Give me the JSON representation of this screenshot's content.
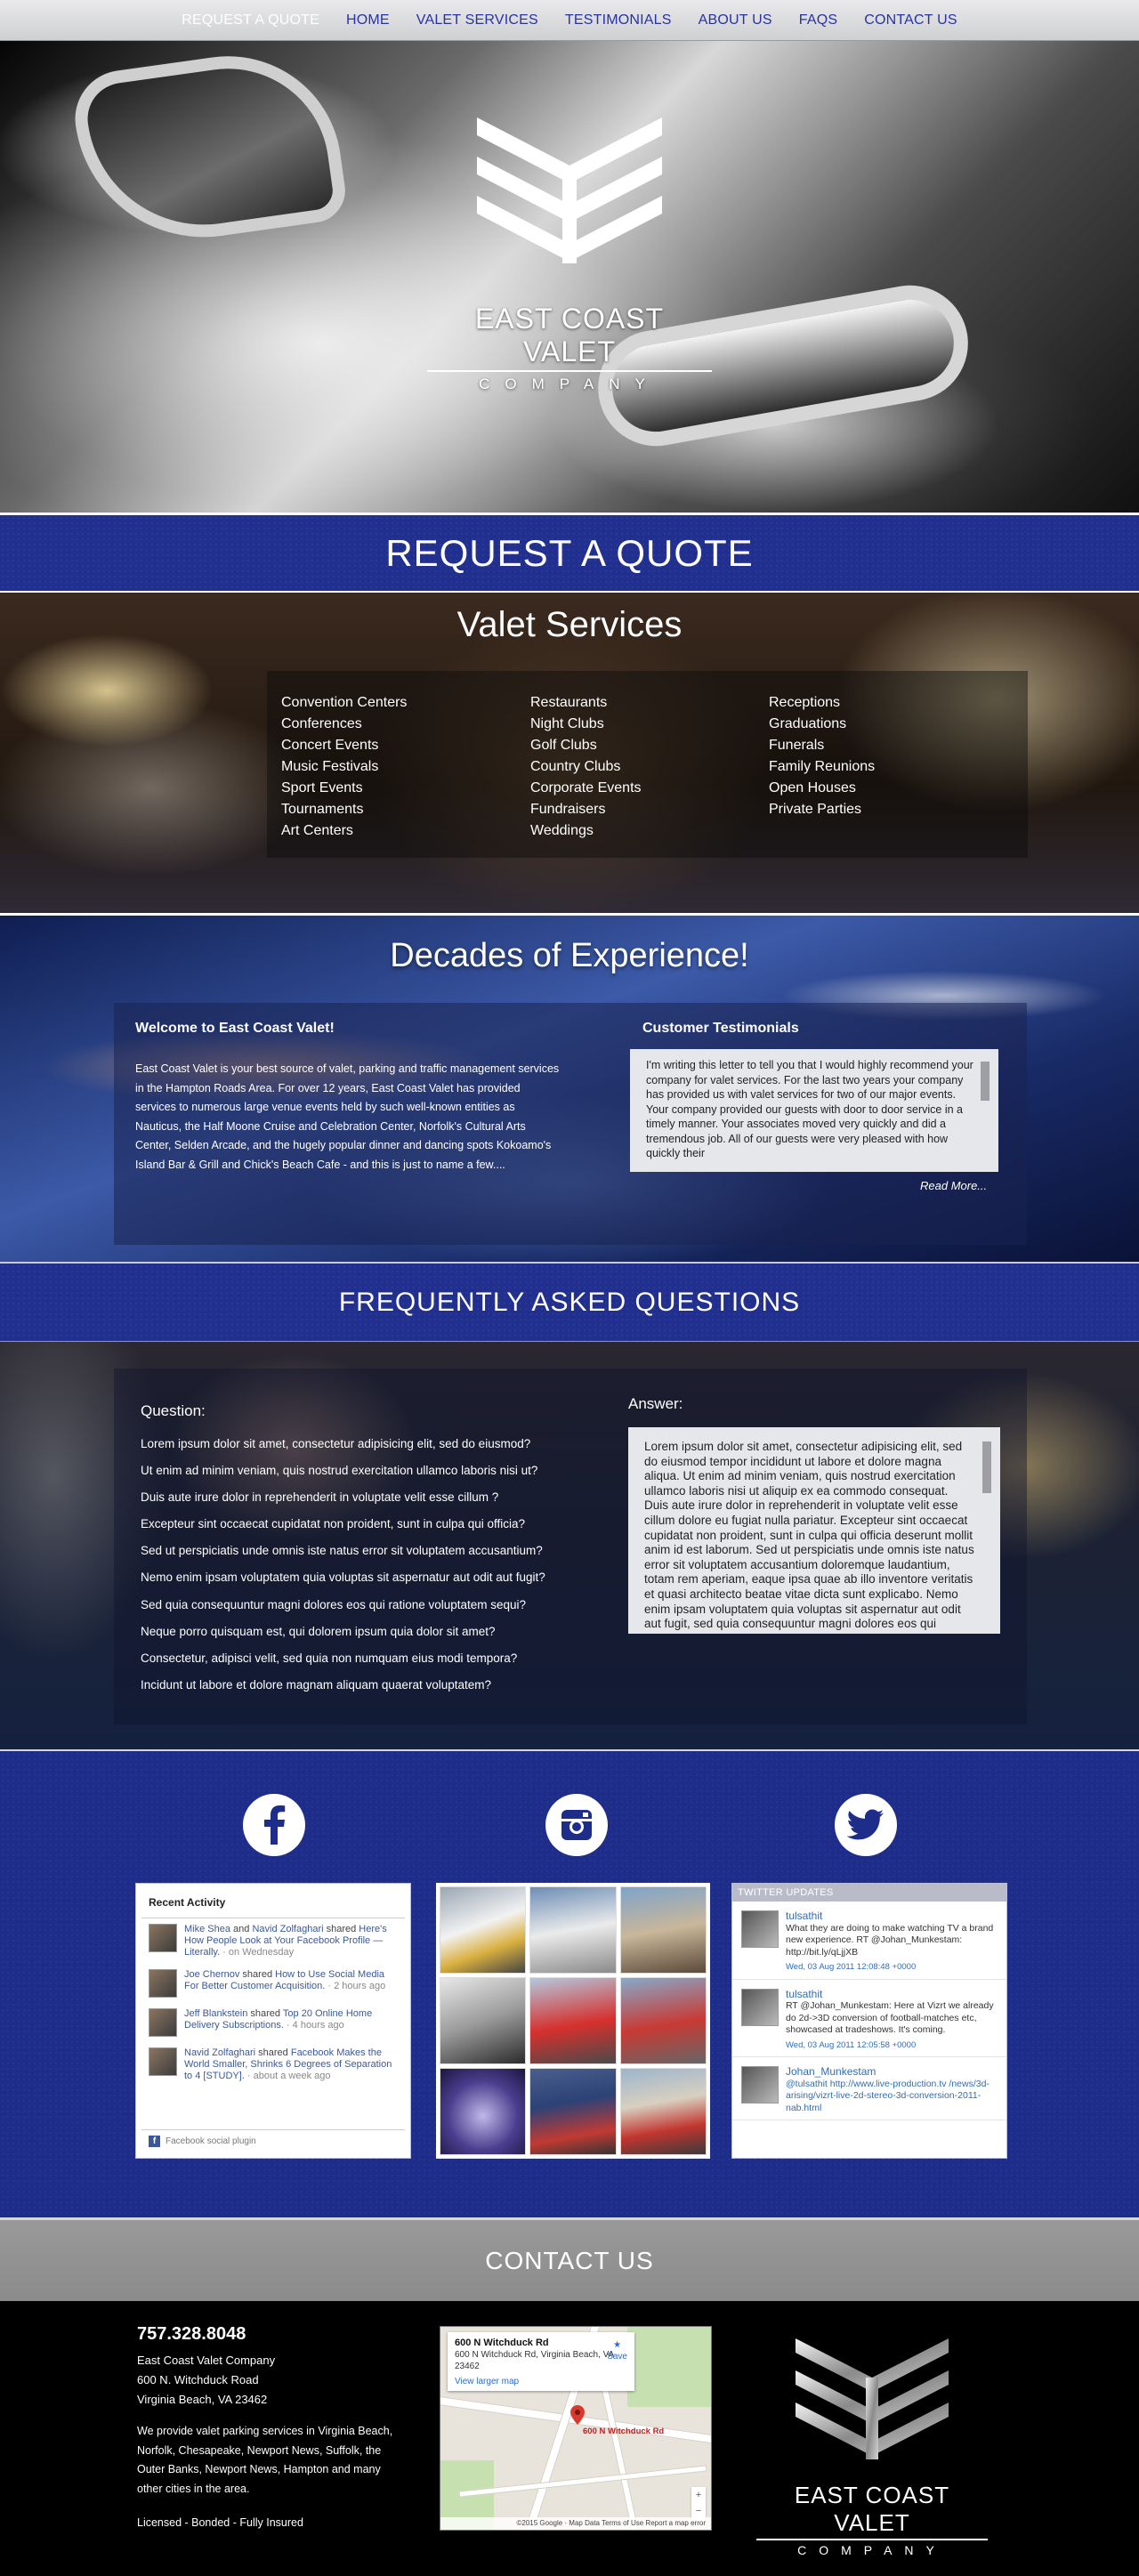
{
  "nav": {
    "items": [
      "REQUEST A QUOTE",
      "HOME",
      "VALET SERVICES",
      "TESTIMONIALS",
      "ABOUT US",
      "FAQS",
      "CONTACT US"
    ],
    "active_index": 0,
    "active_color": "#ffffff",
    "link_color": "#2732a6"
  },
  "hero": {
    "brand": "EAST COAST VALET",
    "company": "COMPANY",
    "logo_icon": "chevron-emblem-icon"
  },
  "quote_band": {
    "title": "REQUEST A QUOTE"
  },
  "services": {
    "title": "Valet Services",
    "columns": [
      [
        "Convention Centers",
        "Conferences",
        "Concert Events",
        "Music Festivals",
        "Sport Events",
        "Tournaments",
        "Art Centers"
      ],
      [
        "Restaurants",
        "Night Clubs",
        "Golf Clubs",
        "Country Clubs",
        "Corporate Events",
        "Fundraisers",
        "Weddings"
      ],
      [
        "Receptions",
        "Graduations",
        "Funerals",
        "Family Reunions",
        "Open Houses",
        "Private Parties"
      ]
    ]
  },
  "experience": {
    "title": "Decades of Experience!",
    "welcome_title": "Welcome to East Coast Valet!",
    "welcome_text": "East Coast Valet is your best source of valet, parking and traffic management services in the Hampton Roads Area. For over 12 years, East Coast Valet has provided services to numerous large venue events held by such well-known entities as Nauticus, the Half Moone Cruise and Celebration Center, Norfolk's Cultural Arts Center, Selden Arcade, and the hugely popular dinner and dancing spots Kokoamo's Island Bar & Grill and Chick's Beach Cafe - and this is just to name a few....",
    "testimonials_title": "Customer Testimonials",
    "testimonial_text": "I'm writing this letter to tell you that I would highly recommend your company for valet services.  For the last two years your company has provided us with valet services for two of our major events.  Your company provided our guests with door to door service in a timely manner.  Your associates moved very quickly and did a tremendous job.  All of our guests were very pleased with how quickly their",
    "read_more": "Read More..."
  },
  "faq_band": {
    "title": "FREQUENTLY ASKED QUESTIONS"
  },
  "faq": {
    "question_label": "Question:",
    "answer_label": "Answer:",
    "questions": [
      "Lorem ipsum dolor sit amet, consectetur adipisicing elit, sed do eiusmod?",
      "Ut enim ad minim veniam, quis nostrud exercitation ullamco laboris nisi ut?",
      "Duis aute irure dolor in reprehenderit in voluptate velit esse cillum ?",
      "Excepteur sint occaecat cupidatat non proident, sunt in culpa qui officia?",
      "Sed ut perspiciatis unde omnis iste natus error sit voluptatem accusantium?",
      "Nemo enim ipsam voluptatem quia voluptas sit aspernatur aut odit aut fugit?",
      "Sed quia consequuntur magni dolores eos qui ratione voluptatem sequi?",
      "Neque porro quisquam est, qui dolorem ipsum quia dolor sit amet?",
      "Consectetur, adipisci velit, sed quia non numquam eius modi tempora?",
      "Incidunt ut labore et dolore magnam aliquam quaerat voluptatem?"
    ],
    "answer_text": "Lorem ipsum dolor sit amet, consectetur adipisicing elit, sed do eiusmod tempor incididunt ut labore et dolore magna aliqua. Ut enim ad minim veniam, quis nostrud exercitation ullamco laboris nisi ut aliquip ex ea commodo consequat. Duis aute irure dolor in reprehenderit in voluptate velit esse cillum dolore eu fugiat nulla pariatur. Excepteur sint occaecat cupidatat non proident, sunt in culpa qui officia deserunt mollit anim id est laborum. Sed ut perspiciatis unde omnis iste natus error sit voluptatem accusantium doloremque laudantium, totam rem aperiam, eaque ipsa quae ab illo inventore veritatis et quasi architecto beatae vitae dicta sunt explicabo. Nemo enim ipsam voluptatem quia voluptas sit aspernatur aut odit aut fugit, sed quia consequuntur magni dolores eos qui ratione voluptatem sequi nesciunt. Neque"
  },
  "social": {
    "icons": [
      "facebook-icon",
      "instagram-icon",
      "twitter-icon"
    ],
    "facebook": {
      "header": "Recent Activity",
      "activities": [
        {
          "actor": "Mike Shea",
          "joiner": " and ",
          "actor2": "Navid Zolfaghari",
          "verb": " shared ",
          "link": "Here's How People Look at Your Facebook Profile — Literally.",
          "meta": " · on Wednesday"
        },
        {
          "actor": "Joe Chernov",
          "joiner": "",
          "actor2": "",
          "verb": " shared ",
          "link": "How to Use Social Media For Better Customer Acquisition.",
          "meta": " · 2 hours ago"
        },
        {
          "actor": "Jeff Blankstein",
          "joiner": "",
          "actor2": "",
          "verb": " shared ",
          "link": "Top 20 Online Home Delivery Subscriptions.",
          "meta": " · 4 hours ago"
        },
        {
          "actor": "Navid Zolfaghari",
          "joiner": "",
          "actor2": "",
          "verb": " shared ",
          "link": "Facebook Makes the World Smaller, Shrinks 6 Degrees of Separation to 4 [STUDY].",
          "meta": " · about a week ago"
        }
      ],
      "footer": "Facebook social plugin"
    },
    "twitter": {
      "header": "TWITTER UPDATES",
      "tweets": [
        {
          "user": "tulsathit",
          "text": "What they are doing to make watching TV a brand new experience. RT @Johan_Munkestam: http://bit.ly/qLjjXB",
          "time": "Wed, 03 Aug 2011 12:08:48 +0000"
        },
        {
          "user": "tulsathit",
          "text": "RT @Johan_Munkestam: Here at Vizrt we already do 2d->3D conversion of football-matches etc, showcased at tradeshows. It's coming.",
          "time": "Wed, 03 Aug 2011 12:05:58 +0000"
        },
        {
          "user": "Johan_Munkestam",
          "text": "@tulsathit http://www.live-production.tv /news/3d-arising/vizrt-live-2d-stereo-3d-conversion-2011-nab.html",
          "time": ""
        }
      ]
    }
  },
  "contact_band": {
    "title": "CONTACT US"
  },
  "contact": {
    "phone": "757.328.8048",
    "company": "East Coast Valet Company",
    "street": "600 N. Witchduck Road",
    "city": "Virginia Beach, VA 23462",
    "description": "We provide valet parking services in Virginia Beach, Norfolk, Chesapeake, Newport News, Suffolk, the Outer Banks, Newport News, Hampton and many other cities in the area.",
    "licensed": "Licensed - Bonded - Fully Insured",
    "map": {
      "place": "600 N Witchduck Rd",
      "address": "600 N Witchduck Rd, Virginia Beach, VA 23462",
      "view_larger": "View larger map",
      "save": "Save",
      "pin_label": "600 N Witchduck Rd",
      "footer": "©2015 Google · Map Data  Terms of Use  Report a map error"
    }
  }
}
